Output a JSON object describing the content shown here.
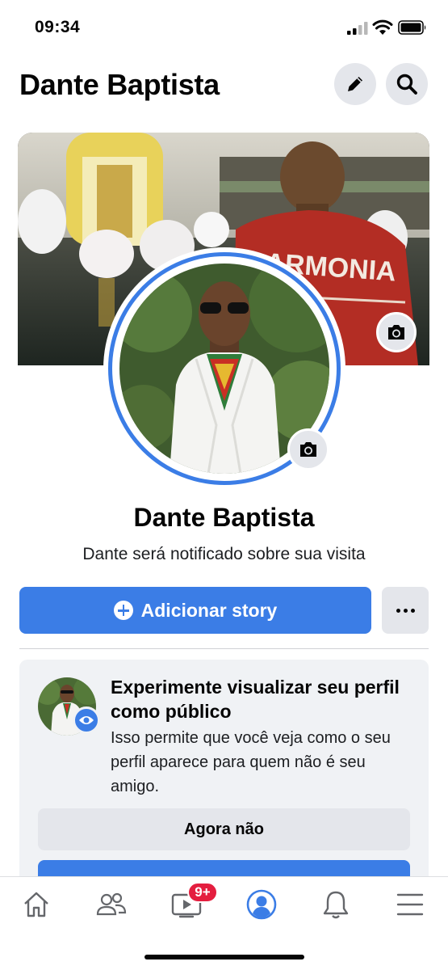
{
  "status_bar": {
    "time": "09:34"
  },
  "header": {
    "title": "Dante Baptista"
  },
  "profile": {
    "name": "Dante Baptista",
    "notice": "Dante será notificado sobre sua visita"
  },
  "actions": {
    "add_story_label": "Adicionar story"
  },
  "suggestion_card": {
    "title": "Experimente visualizar seu perfil como público",
    "body": "Isso permite que você veja como o seu perfil aparece para quem não é seu amigo.",
    "dismiss_label": "Agora não"
  },
  "bottom_nav": {
    "items": [
      "home-icon",
      "friends-icon",
      "video-icon",
      "profile-icon",
      "notifications-icon",
      "menu-icon"
    ],
    "video_badge": "9+",
    "active": "profile"
  },
  "colors": {
    "accent": "#3b7de6",
    "badge": "#e41e3f",
    "gray_button": "#e4e6eb",
    "card_bg": "#f0f2f5"
  }
}
